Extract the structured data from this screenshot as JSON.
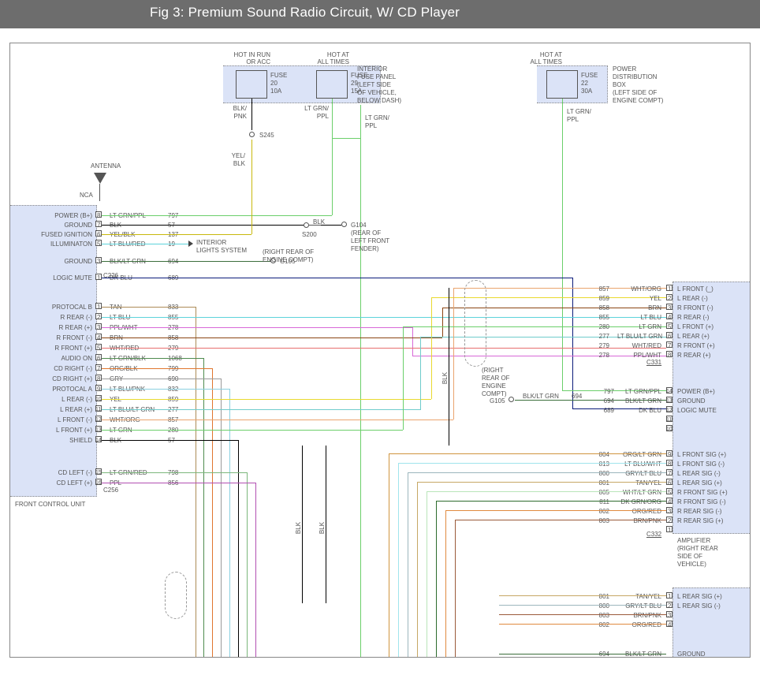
{
  "banner_title": "Fig 3: Premium Sound Radio Circuit, W/ CD Player",
  "power": {
    "hot_run_acc": "HOT IN RUN\nOR ACC",
    "hot_all_times": "HOT AT\nALL TIMES",
    "fuse20": {
      "name": "FUSE",
      "num": "20",
      "amps": "10A"
    },
    "fuse29": {
      "name": "FUSE",
      "num": "29",
      "amps": "15A"
    },
    "fuse22": {
      "name": "FUSE",
      "num": "22",
      "amps": "30A"
    },
    "interior_panel": "INTERIOR\nFUSE PANEL\n(LEFT SIDE\nOF VEHICLE,\nBELOW DASH)",
    "pdb": "POWER\nDISTRIBUTION\nBOX\n(LEFT SIDE OF\nENGINE COMPT)",
    "wire_f20": "BLK/\nPNK",
    "wire_f29": "LT GRN/\nPPL",
    "wire_f29b": "LT GRN/\nPPL",
    "wire_f22": "LT GRN/\nPPL",
    "s245": "S245",
    "yelblk": "YEL/\nBLK"
  },
  "antenna_label": "ANTENNA",
  "nca": "NCA",
  "fcu": {
    "name": "FRONT CONTROL UNIT",
    "c226": "C226",
    "c256": "C256",
    "pins_c226": [
      {
        "pin": "8",
        "label": "POWER (B+)",
        "wire": "LT GRN/PPL",
        "code": "797"
      },
      {
        "pin": "7",
        "label": "GROUND",
        "wire": "BLK",
        "code": "57"
      },
      {
        "pin": "6",
        "label": "FUSED IGNITION",
        "wire": "YEL/BLK",
        "code": "137"
      },
      {
        "pin": "5",
        "label": "ILLUMINATON",
        "wire": "LT BLU/RED",
        "code": "19",
        "note": "INTERIOR\nLIGHTS SYSTEM"
      },
      {
        "pin": "4",
        "label": "",
        "wire": "",
        "code": ""
      },
      {
        "pin": "3",
        "label": "GROUND",
        "wire": "BLK/LT GRN",
        "code": "694"
      },
      {
        "pin": "2",
        "label": "",
        "wire": "",
        "code": ""
      },
      {
        "pin": "1",
        "label": "LOGIC MUTE",
        "wire": "DK BLU",
        "code": "689"
      }
    ],
    "pins_c256": [
      {
        "pin": "1",
        "label": "PROTOCAL B",
        "wire": "TAN",
        "code": "833"
      },
      {
        "pin": "2",
        "label": "R REAR (-)",
        "wire": "LT BLU",
        "code": "855"
      },
      {
        "pin": "3",
        "label": "R REAR (+)",
        "wire": "PPL/WHT",
        "code": "278"
      },
      {
        "pin": "4",
        "label": "R FRONT (-)",
        "wire": "BRN",
        "code": "858"
      },
      {
        "pin": "5",
        "label": "R FRONT (+)",
        "wire": "WHT/RED",
        "code": "279"
      },
      {
        "pin": "6",
        "label": "AUDIO ON",
        "wire": "LT GRN/BLK",
        "code": "1068"
      },
      {
        "pin": "7",
        "label": "CD RIGHT (-)",
        "wire": "ORG/BLK",
        "code": "799"
      },
      {
        "pin": "8",
        "label": "CD RIGHT (+)",
        "wire": "GRY",
        "code": "690"
      },
      {
        "pin": "9",
        "label": "PROTOCAL A",
        "wire": "LT BLU/PNK",
        "code": "832"
      },
      {
        "pin": "10",
        "label": "L REAR (-)",
        "wire": "YEL",
        "code": "859"
      },
      {
        "pin": "11",
        "label": "L REAR (+)",
        "wire": "LT BLU/LT GRN",
        "code": "277"
      },
      {
        "pin": "12",
        "label": "L FRONT (-)",
        "wire": "WHT/ORG",
        "code": "857"
      },
      {
        "pin": "13",
        "label": "L FRONT (+)",
        "wire": "LT GRN",
        "code": "280"
      },
      {
        "pin": "14",
        "label": "SHIELD",
        "wire": "BLK",
        "code": "57"
      },
      {
        "pin": "15",
        "label": "CD LEFT (-)",
        "wire": "LT GRN/RED",
        "code": "798"
      },
      {
        "pin": "16",
        "label": "CD LEFT (+)",
        "wire": "PPL",
        "code": "856"
      }
    ]
  },
  "mid": {
    "s200": "S200",
    "g104": "G104",
    "g104_note": "(REAR OF\nLEFT FRONT\nFENDER)",
    "g105a": "G105",
    "g105a_note": "(RIGHT REAR OF\nENGINE COMPT)",
    "g105b": "G105",
    "g105b_note": "(RIGHT\nREAR OF\nENGINE\nCOMPT)",
    "blk_vert": "BLK",
    "blk_vert2": "BLK",
    "blk_vert3": "BLK",
    "blkltgrn_w": "BLK/LT GRN",
    "blkltgrn_c": "694"
  },
  "amp": {
    "name": "AMPLIFIER\n(RIGHT REAR\nSIDE OF\nVEHICLE)",
    "c331": "C331",
    "c332": "C332",
    "c331_pins": [
      {
        "pin": "1",
        "label": "L FRONT (_)",
        "wire": "WHT/ORG",
        "code": "857"
      },
      {
        "pin": "2",
        "label": "L REAR (-)",
        "wire": "YEL",
        "code": "859"
      },
      {
        "pin": "3",
        "label": "R FRONT (-)",
        "wire": "BRN",
        "code": "858"
      },
      {
        "pin": "4",
        "label": "R REAR (-)",
        "wire": "LT BLU",
        "code": "855"
      },
      {
        "pin": "5",
        "label": "L FRONT (+)",
        "wire": "LT GRN",
        "code": "280"
      },
      {
        "pin": "6",
        "label": "L REAR (+)",
        "wire": "LT BLU/LT GRN",
        "code": "277"
      },
      {
        "pin": "7",
        "label": "R FRONT (+)",
        "wire": "WHT/RED",
        "code": "279"
      },
      {
        "pin": "8",
        "label": "R REAR (+)",
        "wire": "PPL/WHT",
        "code": "278"
      }
    ],
    "c331_bottom": [
      {
        "pin": "14",
        "label": "POWER (B+)",
        "wire": "LT GRN/PPL",
        "code": "797"
      },
      {
        "pin": "13",
        "label": "GROUND",
        "wire": "BLK/LT GRN",
        "code": "694"
      },
      {
        "pin": "12",
        "label": "LOGIC MUTE",
        "wire": "DK BLU",
        "code": "689"
      },
      {
        "pin": "11",
        "label": "",
        "wire": "",
        "code": ""
      },
      {
        "pin": "10",
        "label": "",
        "wire": "",
        "code": ""
      }
    ],
    "c332_pins": [
      {
        "pin": "9",
        "label": "L FRONT SIG (+)",
        "wire": "ORG/LT GRN",
        "code": "804"
      },
      {
        "pin": "8",
        "label": "L FRONT SIG (-)",
        "wire": "LT BLU/WHT",
        "code": "813"
      },
      {
        "pin": "7",
        "label": "L REAR SIG (-)",
        "wire": "GRY/LT BLU",
        "code": "800"
      },
      {
        "pin": "6",
        "label": "L REAR SIG (+)",
        "wire": "TAN/YEL",
        "code": "801"
      },
      {
        "pin": "5",
        "label": "R FRONT SIG (+)",
        "wire": "WHT/LT GRN",
        "code": "805"
      },
      {
        "pin": "4",
        "label": "R FRONT SIG (-)",
        "wire": "DK GRN/ORG",
        "code": "811"
      },
      {
        "pin": "3",
        "label": "R REAR SIG (-)",
        "wire": "ORG/RED",
        "code": "802"
      },
      {
        "pin": "2",
        "label": "R REAR SIG (+)",
        "wire": "BRN/PNK",
        "code": "803"
      },
      {
        "pin": "1",
        "label": "",
        "wire": "",
        "code": ""
      }
    ]
  },
  "spk_lrear": {
    "rows": [
      {
        "pin": "1",
        "label": "L REAR SIG (+)",
        "wire": "TAN/YEL",
        "code": "801"
      },
      {
        "pin": "2",
        "label": "L REAR SIG (-)",
        "wire": "GRY/LT BLU",
        "code": "800"
      },
      {
        "pin": "3",
        "label": "",
        "wire": "BRN/PNK",
        "code": "803"
      },
      {
        "pin": "4",
        "label": "",
        "wire": "ORG/RED",
        "code": "802"
      }
    ],
    "ground": {
      "wire": "BLK/LT GRN",
      "code": "694",
      "label": "GROUND"
    }
  }
}
